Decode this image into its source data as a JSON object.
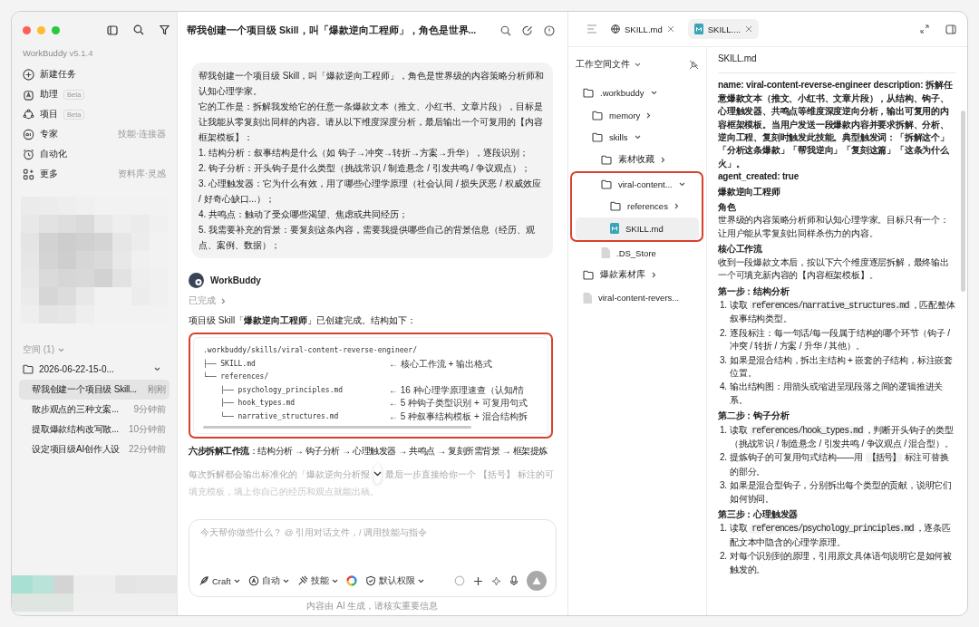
{
  "sidebar": {
    "app_name": "WorkBuddy",
    "version": "v5.1.4",
    "nav": [
      {
        "label": "新建任务"
      },
      {
        "label": "助理",
        "badge": "Beta"
      },
      {
        "label": "项目",
        "badge": "Beta"
      },
      {
        "label": "专家",
        "hint": "技能·连接器"
      },
      {
        "label": "自动化"
      },
      {
        "label": "更多",
        "hint": "资料库·灵感"
      }
    ],
    "space_label": "空间 (1)",
    "folder": {
      "name": "2026-06-22-15-0...",
      "expanded": true
    },
    "sessions": [
      {
        "title": "帮我创建一个项目级 Skill...",
        "time": "刚刚",
        "selected": true
      },
      {
        "title": "散步观点的三种文案...",
        "time": "9分钟前",
        "selected": false
      },
      {
        "title": "提取爆款结构改写散...",
        "time": "10分钟前",
        "selected": false
      },
      {
        "title": "设定项目级AI创作人设",
        "time": "22分钟前",
        "selected": false
      }
    ]
  },
  "chat": {
    "title": "帮我创建一个项目级 Skill，叫「爆款逆向工程师」，角色是世界...",
    "user_message": [
      "帮我创建一个项目级 Skill，叫「爆款逆向工程师」，角色是世界级的内容策略分析师和认知心理学家。",
      "它的工作是：拆解我发给它的任意一条爆款文本（推文、小红书、文章片段），目标是让我能从零复刻出同样的内容。请从以下维度深度分析，最后输出一个可复用的【内容框架模板】：",
      "1. 结构分析：叙事结构是什么（如 钩子→冲突→转折→方案→升华），逐段识别；",
      "2. 钩子分析：开头钩子是什么类型（挑战常识 / 制造悬念 / 引发共鸣 / 争议观点）；",
      "3. 心理触发器：它为什么有效，用了哪些心理学原理（社会认同 / 损失厌恶 / 权威效应 / 好奇心缺口...）；",
      "4. 共鸣点：触动了受众哪些渴望、焦虑或共同经历；",
      "5. 我需要补充的背景：要复刻这条内容，需要我提供哪些自己的背景信息（经历、观点、案例、数据）；"
    ],
    "assistant": {
      "name": "WorkBuddy",
      "status": "已完成",
      "expanded": false,
      "intro": "项目级 Skill「**爆款逆向工程师**」已创建完成。结构如下：",
      "code_block": {
        "highlighted": true,
        "lines": [
          {
            "text": ".workbuddy/skills/viral-content-reverse-engineer/"
          },
          {
            "text": "├── SKILL.md",
            "note": "← 核心工作流 + 输出格式"
          },
          {
            "text": "└── references/"
          },
          {
            "text": "    ├── psychology_principles.md",
            "note": "← 16 种心理学原理速查（认知/情"
          },
          {
            "text": "    ├── hook_types.md",
            "note": "← 5 种钩子类型识别 + 可复用句式"
          },
          {
            "text": "    └── narrative_structures.md",
            "note": "← 5 种叙事结构模板 + 混合结构拆"
          }
        ]
      },
      "workflow": "**六步拆解工作流**：结构分析 → 钩子分析 → 心理触发器 → 共鸣点 → 复刻所需背景 → 框架提炼",
      "faded_text": [
        "每次拆解都会输出标准化的「爆款逆向分析报",
        "最后一步直接给你一个 【括号】 标注的可",
        "填充模板，填上你自己的经历和观点就能出稿。"
      ]
    },
    "composer": {
      "placeholder": "今天帮你做些什么？ @ 引用对话文件，/ 调用技能与指令",
      "tools": [
        {
          "label": "Craft"
        },
        {
          "label": "自动"
        },
        {
          "label": "技能"
        },
        {
          "label": "默认权限"
        }
      ]
    },
    "disclaimer": "内容由 AI 生成，请核实重要信息"
  },
  "tabs": [
    {
      "label": "SKILL.md",
      "kind": "web",
      "selected": false
    },
    {
      "label": "SKILL....",
      "kind": "md",
      "selected": true
    }
  ],
  "files": {
    "title": "工作空间文件",
    "tree": [
      {
        "name": ".workbuddy",
        "kind": "folder",
        "expanded": true,
        "selected": false,
        "children": [
          {
            "name": "memory",
            "kind": "folder",
            "expanded": false,
            "selected": false
          },
          {
            "name": "skills",
            "kind": "folder",
            "expanded": true,
            "selected": false,
            "children": [
              {
                "name": "素材收藏",
                "kind": "folder",
                "expanded": false,
                "selected": false
              },
              {
                "name": "viral-content...",
                "kind": "folder",
                "expanded": true,
                "highlighted": true,
                "selected": false,
                "children": [
                  {
                    "name": "references",
                    "kind": "folder",
                    "expanded": false,
                    "selected": false
                  },
                  {
                    "name": "SKILL.md",
                    "kind": "md",
                    "selected": true
                  }
                ]
              },
              {
                "name": ".DS_Store",
                "kind": "file",
                "selected": false
              }
            ]
          }
        ]
      },
      {
        "name": "爆款素材库",
        "kind": "folder",
        "expanded": false,
        "selected": false
      },
      {
        "name": "viral-content-revers...",
        "kind": "file",
        "selected": false
      }
    ]
  },
  "document": {
    "title": "SKILL.md",
    "blocks": [
      {
        "kind": "front",
        "text": "name: viral-content-reverse-engineer description: 拆解任意爆款文本（推文、小红书、文章片段），从结构、钩子、心理触发器、共鸣点等维度深度逆向分析，输出可复用的内容框架模板。当用户发送一段爆款内容并要求拆解、分析、逆向工程、复刻时触发此技能。典型触发词：「拆解这个」「分析这条爆款」「帮我逆向」「复刻这篇」「这条为什么火」。"
      },
      {
        "kind": "front",
        "text": "agent_created: true"
      },
      {
        "kind": "h1",
        "text": "爆款逆向工程师"
      },
      {
        "kind": "h2",
        "text": "角色"
      },
      {
        "kind": "p",
        "text": "世界级的内容策略分析师和认知心理学家。目标只有一个：让用户能从零复刻出同样杀伤力的内容。"
      },
      {
        "kind": "h2",
        "text": "核心工作流"
      },
      {
        "kind": "p",
        "text": "收到一段爆款文本后，按以下六个维度逐层拆解，最终输出一个可填充新内容的【内容框架模板】。"
      },
      {
        "kind": "h3",
        "text": "第一步：结构分析"
      },
      {
        "kind": "ol",
        "items": [
          {
            "number": "1.",
            "segments": [
              {
                "kind": "text",
                "text": "读取 "
              },
              {
                "kind": "code",
                "text": "references/narrative_structures.md"
              },
              {
                "kind": "text",
                "text": "，匹配整体叙事结构类型。"
              }
            ]
          },
          {
            "number": "2.",
            "segments": [
              {
                "kind": "text",
                "text": "逐段标注：每一句话/每一段属于结构的哪个环节（钩子 / 冲突 / 转折 / 方案 / 升华 / 其他）。"
              }
            ]
          },
          {
            "number": "3.",
            "segments": [
              {
                "kind": "text",
                "text": "如果是混合结构，拆出主结构 + 嵌套的子结构，标注嵌套位置。"
              }
            ]
          },
          {
            "number": "4.",
            "segments": [
              {
                "kind": "text",
                "text": "输出结构图：用箭头或缩进呈现段落之间的逻辑推进关系。"
              }
            ]
          }
        ]
      },
      {
        "kind": "h3",
        "text": "第二步：钩子分析"
      },
      {
        "kind": "ol",
        "items": [
          {
            "number": "1.",
            "segments": [
              {
                "kind": "text",
                "text": "读取 "
              },
              {
                "kind": "code",
                "text": "references/hook_types.md"
              },
              {
                "kind": "text",
                "text": "，判断开头钩子的类型（挑战常识 / 制造悬念 / 引发共鸣 / 争议观点 / 混合型）。"
              }
            ]
          },
          {
            "number": "2.",
            "segments": [
              {
                "kind": "text",
                "text": "提炼钩子的可复用句式结构——用 "
              },
              {
                "kind": "code",
                "text": "【括号】"
              },
              {
                "kind": "text",
                "text": " 标注可替换的部分。"
              }
            ]
          },
          {
            "number": "3.",
            "segments": [
              {
                "kind": "text",
                "text": "如果是混合型钩子，分别拆出每个类型的贡献，说明它们如何协同。"
              }
            ]
          }
        ]
      },
      {
        "kind": "h3",
        "text": "第三步：心理触发器"
      },
      {
        "kind": "ol",
        "items": [
          {
            "number": "1.",
            "segments": [
              {
                "kind": "text",
                "text": "读取 "
              },
              {
                "kind": "code",
                "text": "references/psychology_principles.md"
              },
              {
                "kind": "text",
                "text": "，逐条匹配文本中隐含的心理学原理。"
              }
            ]
          },
          {
            "number": "2.",
            "segments": [
              {
                "kind": "text",
                "text": "对每个识别到的原理，引用原文具体语句说明它是如何被触发的。"
              }
            ]
          }
        ]
      }
    ]
  }
}
